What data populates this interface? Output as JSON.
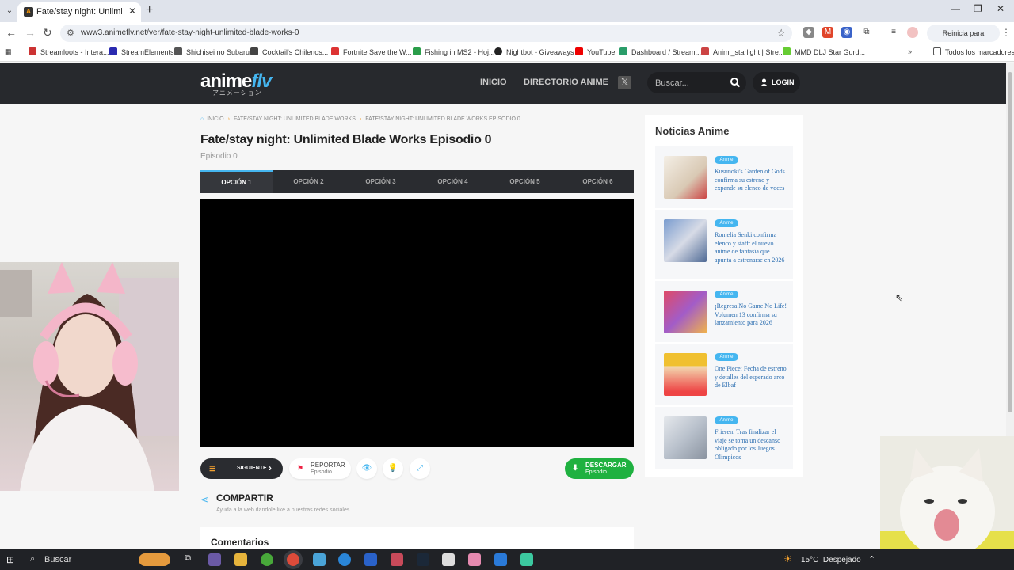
{
  "browser": {
    "tab_title": "Fate/stay night: Unlimited Blade",
    "url": "www3.animeflv.net/ver/fate-stay-night-unlimited-blade-works-0",
    "update_label": "Reinicia para actualizar",
    "bookmarks": [
      "Streamloots - Intera...",
      "StreamElements",
      "Shichisei no Subaru",
      "Cocktail's Chilenos...",
      "Fortnite Save the W...",
      "Fishing in MS2 - Hoj...",
      "Nightbot - Giveaways",
      "YouTube",
      "Dashboard / Stream...",
      "Animi_starlight | Stre...",
      "MMD DLJ Star Gurd..."
    ],
    "all_bookmarks": "Todos los marcadores"
  },
  "site": {
    "logo_main": "anime",
    "logo_accent": "flv",
    "logo_sub": "アニメーション",
    "nav": [
      "INICIO",
      "DIRECTORIO ANIME"
    ],
    "search_placeholder": "Buscar...",
    "login": "LOGIN"
  },
  "breadcrumbs": [
    "INICIO",
    "FATE/STAY NIGHT: UNLIMITED BLADE WORKS",
    "FATE/STAY NIGHT: UNLIMITED BLADE WORKS EPISODIO 0"
  ],
  "episode": {
    "title": "Fate/stay night: Unlimited Blade Works Episodio 0",
    "subtitle": "Episodio 0"
  },
  "options": [
    "OPCIÓN 1",
    "OPCIÓN 2",
    "OPCIÓN 3",
    "OPCIÓN 4",
    "OPCIÓN 5",
    "OPCIÓN 6"
  ],
  "controls": {
    "next": "SIGUIENTE",
    "report": "REPORTAR",
    "report_sub": "Episodio",
    "download": "DESCARGAR",
    "download_sub": "Episodio"
  },
  "share": {
    "title": "COMPARTIR",
    "subtitle": "Ayuda a la web dandole like a nuestras redes sociales"
  },
  "comments_title": "Comentarios",
  "news": {
    "title": "Noticias Anime",
    "items": [
      {
        "tag": "Anime",
        "text": "Kusunoki's Garden of Gods confirma su estreno y expande su elenco de voces"
      },
      {
        "tag": "Anime",
        "text": "Romelia Senki confirma elenco y staff: el nuevo anime de fantasía que apunta a estrenarse en 2026"
      },
      {
        "tag": "Anime",
        "text": "¡Regresa No Game No Life! Volumen 13 confirma su lanzamiento para 2026"
      },
      {
        "tag": "Anime",
        "text": "One Piece: Fecha de estreno y detalles del esperado arco de Elbaf"
      },
      {
        "tag": "Anime",
        "text": "Frieren: Tras finalizar el viaje se toma un descanso obligado por los Juegos Olímpicos"
      }
    ]
  },
  "taskbar": {
    "search": "Buscar",
    "temperature": "15°C",
    "weather": "Despejado"
  },
  "colors": {
    "accent": "#45b6f0",
    "header_bg": "#27292d",
    "download_green": "#1fb140",
    "breadcrumb_sep": "#f0a030"
  }
}
